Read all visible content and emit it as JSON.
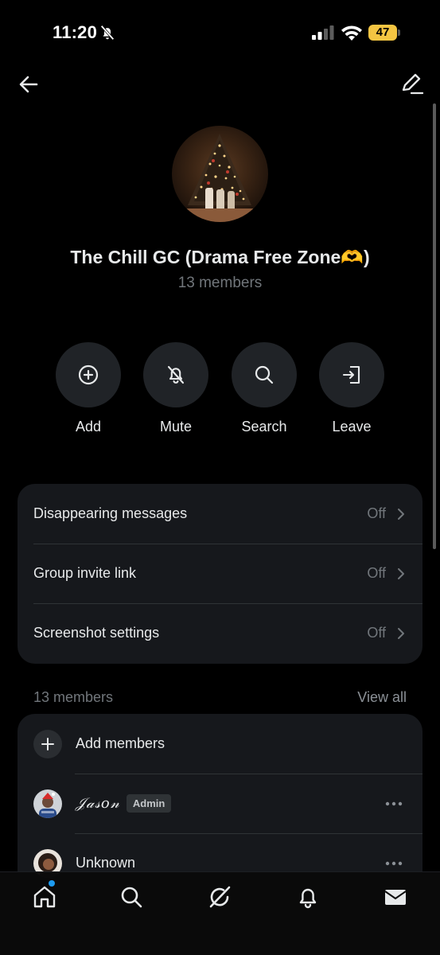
{
  "status_bar": {
    "time": "11:20",
    "battery": "47"
  },
  "group": {
    "name": "The Chill GC (Drama Free Zone🫶)",
    "member_count": "13 members"
  },
  "actions": [
    {
      "label": "Add",
      "icon": "plus-circle-icon"
    },
    {
      "label": "Mute",
      "icon": "bell-off-icon"
    },
    {
      "label": "Search",
      "icon": "search-icon"
    },
    {
      "label": "Leave",
      "icon": "leave-icon"
    }
  ],
  "settings": [
    {
      "label": "Disappearing messages",
      "value": "Off"
    },
    {
      "label": "Group invite link",
      "value": "Off"
    },
    {
      "label": "Screenshot settings",
      "value": "Off"
    }
  ],
  "members": {
    "header": "13 members",
    "view_all": "View all",
    "add_label": "Add members",
    "list": [
      {
        "name": "𝒥𝒶𝓈𝑜𝓃",
        "badge": "Admin"
      },
      {
        "name": "Unknown"
      }
    ]
  },
  "bottom_nav": [
    "home-icon",
    "search-icon",
    "grok-icon",
    "notifications-icon",
    "messages-icon"
  ],
  "colors": {
    "background": "#000000",
    "card": "#16181c",
    "muted_text": "#71767b",
    "accent_dot": "#1d9bf0",
    "battery": "#f4c542"
  }
}
